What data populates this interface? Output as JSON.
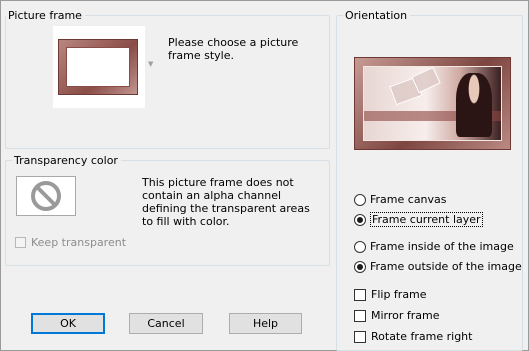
{
  "picture_frame": {
    "title": "Picture frame",
    "choose_text": "Please choose a picture frame style."
  },
  "transparency": {
    "title": "Transparency color",
    "no_alpha_text": "This picture frame does not contain an alpha channel defining the transparent areas to fill with color.",
    "keep_transparent_label": "Keep transparent",
    "keep_transparent_checked": false,
    "keep_transparent_enabled": false
  },
  "buttons": {
    "ok": "OK",
    "cancel": "Cancel",
    "help": "Help"
  },
  "orientation": {
    "title": "Orientation",
    "frame_canvas": "Frame canvas",
    "frame_current_layer": "Frame current layer",
    "frame_inside": "Frame inside of the image",
    "frame_outside": "Frame outside of the image",
    "layer_target_selected": "frame_current_layer",
    "position_selected": "frame_outside",
    "flip_frame": "Flip frame",
    "mirror_frame": "Mirror frame",
    "rotate_frame_right": "Rotate frame right",
    "flip_checked": false,
    "mirror_checked": false,
    "rotate_checked": false
  },
  "icons": {
    "no_alpha": "prohibited-icon",
    "dropdown": "triangle-down-icon"
  },
  "colors": {
    "default_button_border": "#0078d7",
    "frame_color": "#8a4c47"
  }
}
